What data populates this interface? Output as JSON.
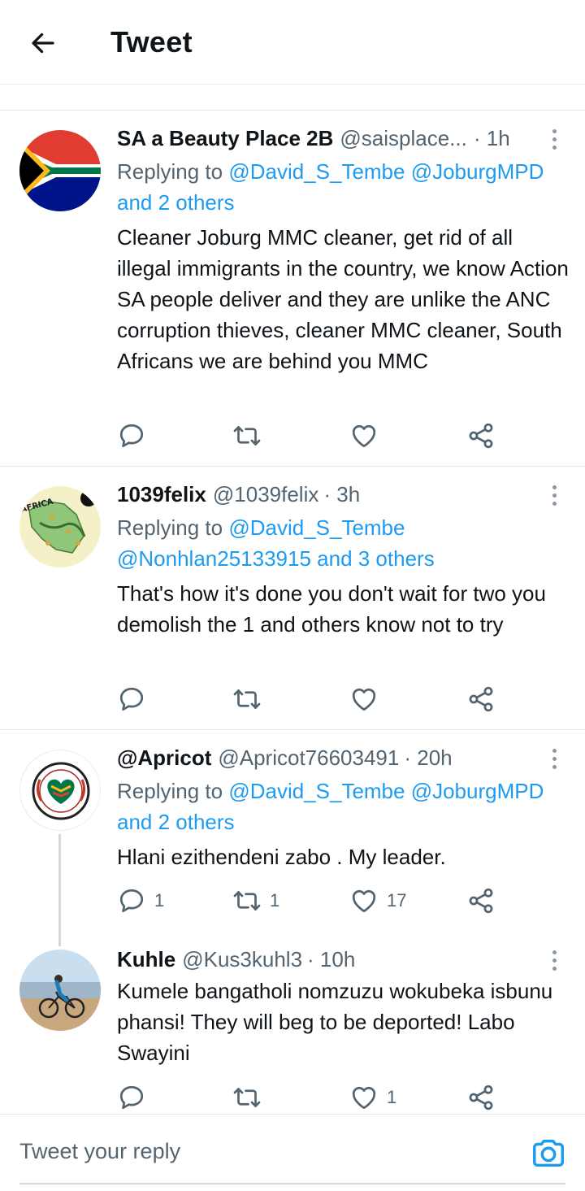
{
  "header": {
    "title": "Tweet"
  },
  "tweets": [
    {
      "name": "SA a Beauty Place 2B",
      "handle": "@saisplace...",
      "time": "· 1h",
      "replying_prefix": "Replying to ",
      "replying_to": "@David_S_Tembe @JoburgMPD",
      "replying_others": "and 2 others",
      "body": "Cleaner Joburg MMC cleaner, get rid of all illegal immigrants in the country, we know Action SA people deliver and they are unlike the ANC corruption thieves, cleaner MMC cleaner, South Africans we are behind you MMC",
      "replies": "",
      "retweets": "",
      "likes": ""
    },
    {
      "name": "1039felix",
      "handle": "@1039felix",
      "time": "· 3h",
      "replying_prefix": "Replying to ",
      "replying_to": "@David_S_Tembe",
      "replying_others": "@Nonhlan25133915 and 3 others",
      "body": "That's how it's done you don't wait for two you demolish the 1 and others know not to try",
      "replies": "",
      "retweets": "",
      "likes": ""
    },
    {
      "name": "@Apricot",
      "handle": "@Apricot76603491",
      "time": "· 20h",
      "replying_prefix": "Replying to ",
      "replying_to": "@David_S_Tembe @JoburgMPD",
      "replying_others": "and 2 others",
      "body": "Hlani ezithendeni zabo . My leader.",
      "replies": "1",
      "retweets": "1",
      "likes": "17"
    },
    {
      "name": "Kuhle",
      "handle": "@Kus3kuhl3",
      "time": "· 10h",
      "body": "Kumele bangatholi nomzuzu wokubeka isbunu phansi! They will beg to be deported! Labo Swayini",
      "replies": "",
      "retweets": "",
      "likes": "1"
    }
  ],
  "reply_bar": {
    "placeholder": "Tweet your reply"
  },
  "colors": {
    "accent": "#1d9bf0",
    "secondary_text": "#536471",
    "divider": "#e1e8ed"
  },
  "icons": [
    "back-arrow-icon",
    "reply-icon",
    "retweet-icon",
    "like-icon",
    "share-icon",
    "more-icon",
    "camera-icon"
  ]
}
